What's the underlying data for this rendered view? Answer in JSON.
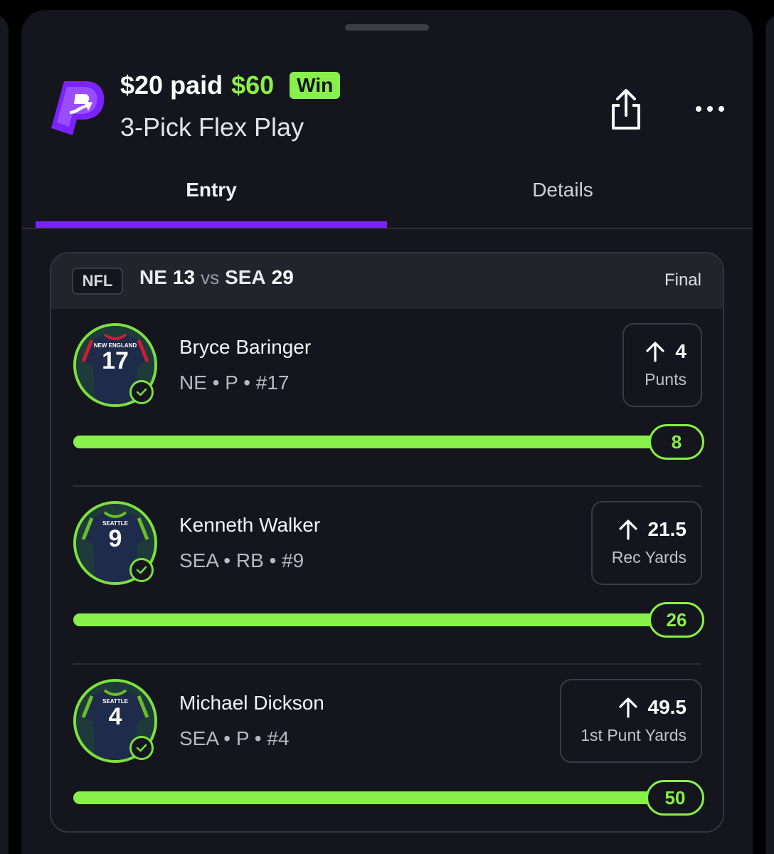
{
  "header": {
    "paid_text": "$20 paid",
    "won_amount": "$60",
    "result_badge": "Win",
    "play_type": "3-Pick Flex Play"
  },
  "tabs": [
    {
      "label": "Entry",
      "active": true
    },
    {
      "label": "Details",
      "active": false
    }
  ],
  "game": {
    "league": "NFL",
    "away_team": "NE",
    "away_score": "13",
    "vs": "vs",
    "home_team": "SEA",
    "home_score": "29",
    "status": "Final"
  },
  "picks": [
    {
      "name": "Bryce Baringer",
      "meta": "NE • P • #17",
      "jersey_team": "NEW ENGLAND",
      "jersey_number": "17",
      "direction": "up",
      "line": "4",
      "stat": "Punts",
      "actual": "8",
      "progress": 1.0
    },
    {
      "name": "Kenneth Walker",
      "meta": "SEA • RB • #9",
      "jersey_team": "SEATTLE",
      "jersey_number": "9",
      "direction": "up",
      "line": "21.5",
      "stat": "Rec Yards",
      "actual": "26",
      "progress": 1.0
    },
    {
      "name": "Michael Dickson",
      "meta": "SEA • P • #4",
      "jersey_team": "SEATTLE",
      "jersey_number": "4",
      "direction": "up",
      "line": "49.5",
      "stat": "1st Punt Yards",
      "actual": "50",
      "progress": 1.0
    }
  ],
  "colors": {
    "accent_green": "#88f04a",
    "brand_purple": "#7b23ff",
    "background": "#15151d"
  },
  "icons": {
    "logo": "prizepicks-logo",
    "share": "share-icon",
    "more": "more-icon",
    "arrow": "arrow-up-icon",
    "check": "check-icon"
  }
}
